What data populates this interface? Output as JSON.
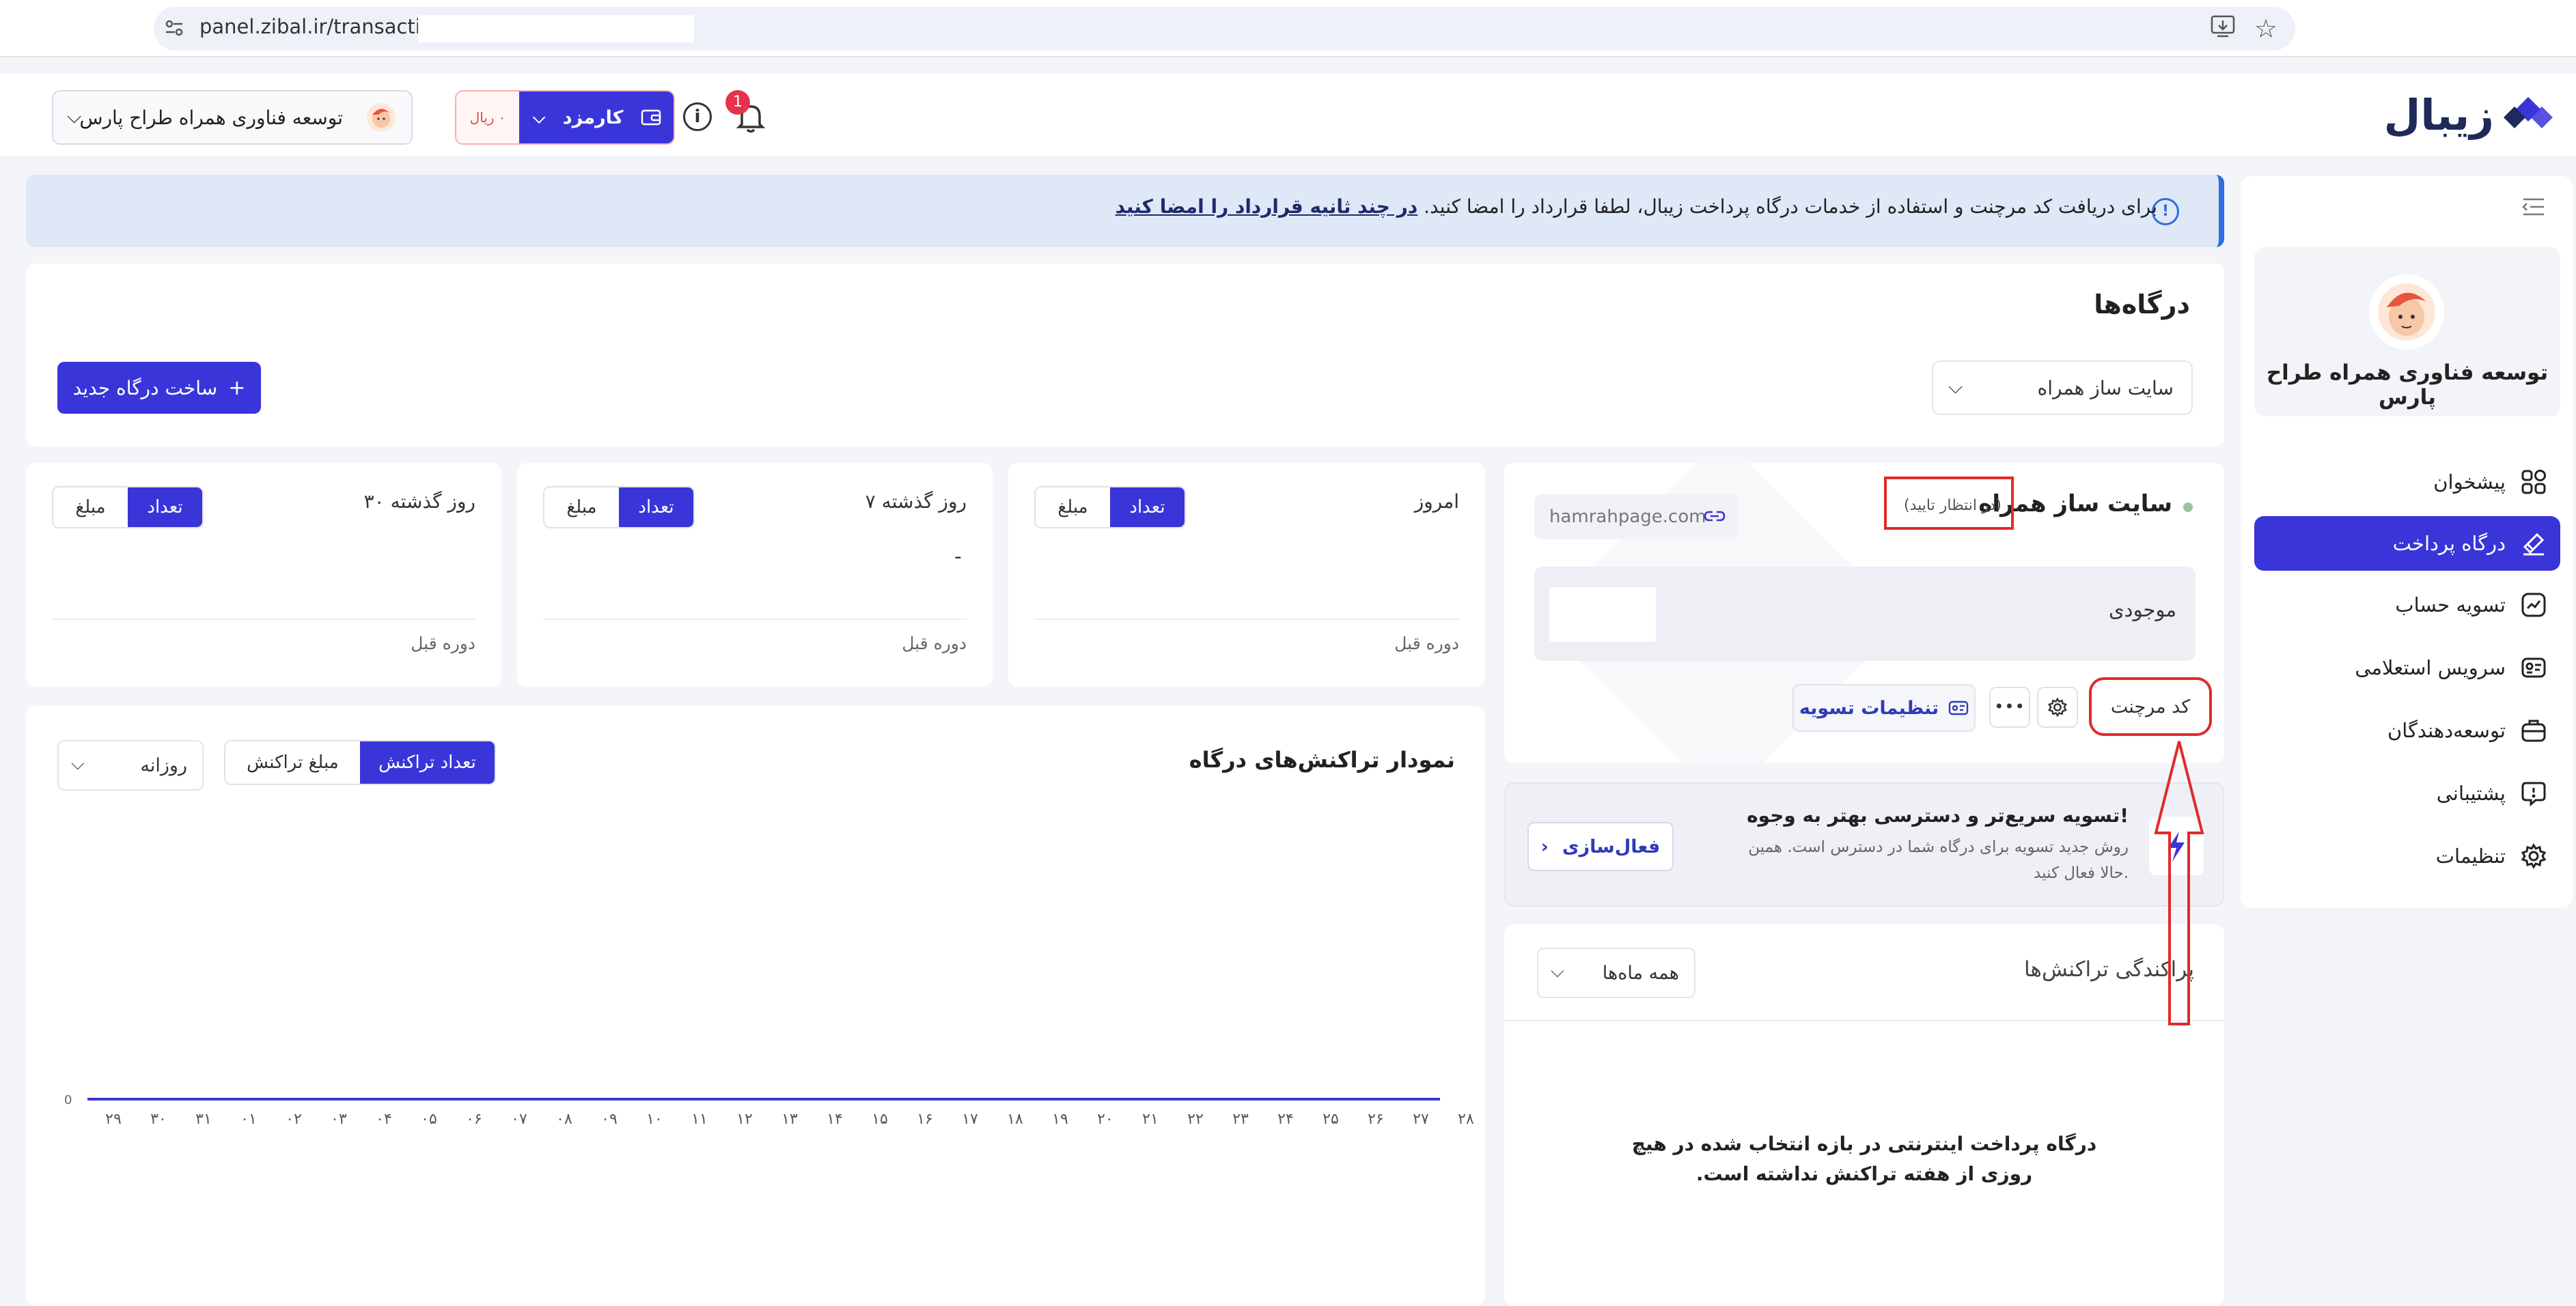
{
  "browser": {
    "url": "panel.zibal.ir/transactions/"
  },
  "brand": {
    "logo_text": "زیبال",
    "accent": "#3a35d9"
  },
  "header": {
    "merchant_name": "توسعه فناوری همراه طراح پارس",
    "fee_label": "کارمزد",
    "fee_amount": "۰",
    "fee_currency": "ریال",
    "notifications_count": "1"
  },
  "sidebar": {
    "profile_name": "توسعه فناوری همراه طراح پارس",
    "items": [
      {
        "label": "پیشخوان",
        "icon": "grid-icon"
      },
      {
        "label": "درگاه پرداخت",
        "icon": "gateway-icon",
        "active": true
      },
      {
        "label": "تسویه حساب",
        "icon": "chart-line-icon"
      },
      {
        "label": "سرویس استعلامی",
        "icon": "id-card-icon"
      },
      {
        "label": "توسعه‌دهندگان",
        "icon": "briefcase-icon"
      },
      {
        "label": "پشتیبانی",
        "icon": "help-chat-icon"
      },
      {
        "label": "تنظیمات",
        "icon": "gear-icon"
      }
    ]
  },
  "banner": {
    "text": "برای دریافت کد مرچنت و استفاده از خدمات درگاه پرداخت زیبال، لطفا قرارداد را امضا کنید.",
    "link": "در چند ثانیه قرارداد را امضا کنید"
  },
  "gateways": {
    "title": "درگاه‌ها",
    "selected": "سایت ساز همراه",
    "new_button": "ساخت درگاه جدید"
  },
  "stats": [
    {
      "title": "امروز",
      "count_label": "تعداد",
      "amount_label": "مبلغ",
      "prev_label": "دوره قبل",
      "value": ""
    },
    {
      "title": "۷ روز گذشته",
      "count_label": "تعداد",
      "amount_label": "مبلغ",
      "prev_label": "دوره قبل",
      "value": "-"
    },
    {
      "title": "۳۰ روز گذشته",
      "count_label": "تعداد",
      "amount_label": "مبلغ",
      "prev_label": "دوره قبل",
      "value": ""
    }
  ],
  "gateway_detail": {
    "name": "سایت ساز همراه",
    "status": "(در انتظار تایید)",
    "domain": "hamrahpage.com",
    "balance_label": "موجودی",
    "merchant_code_label": "کد مرچنت",
    "settlement_settings_label": "تنظیمات تسویه"
  },
  "promo": {
    "title": "تسویه سریع‌تر و دسترسی بهتر به وجوه!",
    "desc": "روش جدید تسویه برای درگاه شما در دسترس است. همین حالا فعال کنید.",
    "button": "فعال‌سازی"
  },
  "distribution": {
    "title": "پراکندگی تراکنش‌ها",
    "filter": "همه ماه‌ها",
    "empty": "درگاه پرداخت اینترنتی در بازه انتخاب شده در هیچ روزی از هفته تراکنش نداشته است."
  },
  "chart_panel": {
    "title": "نمودار تراکنش‌های درگاه",
    "count_tab": "تعداد تراکنش",
    "amount_tab": "مبلغ تراکنش",
    "period": "روزانه"
  },
  "chart_data": {
    "type": "line",
    "x": [
      "۲۹",
      "۳۰",
      "۳۱",
      "۰۱",
      "۰۲",
      "۰۳",
      "۰۴",
      "۰۵",
      "۰۶",
      "۰۷",
      "۰۸",
      "۰۹",
      "۱۰",
      "۱۱",
      "۱۲",
      "۱۳",
      "۱۴",
      "۱۵",
      "۱۶",
      "۱۷",
      "۱۸",
      "۱۹",
      "۲۰",
      "۲۱",
      "۲۲",
      "۲۳",
      "۲۴",
      "۲۵",
      "۲۶",
      "۲۷",
      "۲۸"
    ],
    "series": [
      {
        "values": [
          0,
          0,
          0,
          0,
          0,
          0,
          0,
          0,
          0,
          0,
          0,
          0,
          0,
          0,
          0,
          0,
          0,
          0,
          0,
          0,
          0,
          0,
          0,
          0,
          0,
          0,
          0,
          0,
          0,
          0,
          0
        ]
      }
    ],
    "y_ticks": [
      "0"
    ],
    "ylim": [
      0,
      1
    ],
    "title": "",
    "xlabel": "",
    "ylabel": "",
    "color": "#3a35d9"
  }
}
